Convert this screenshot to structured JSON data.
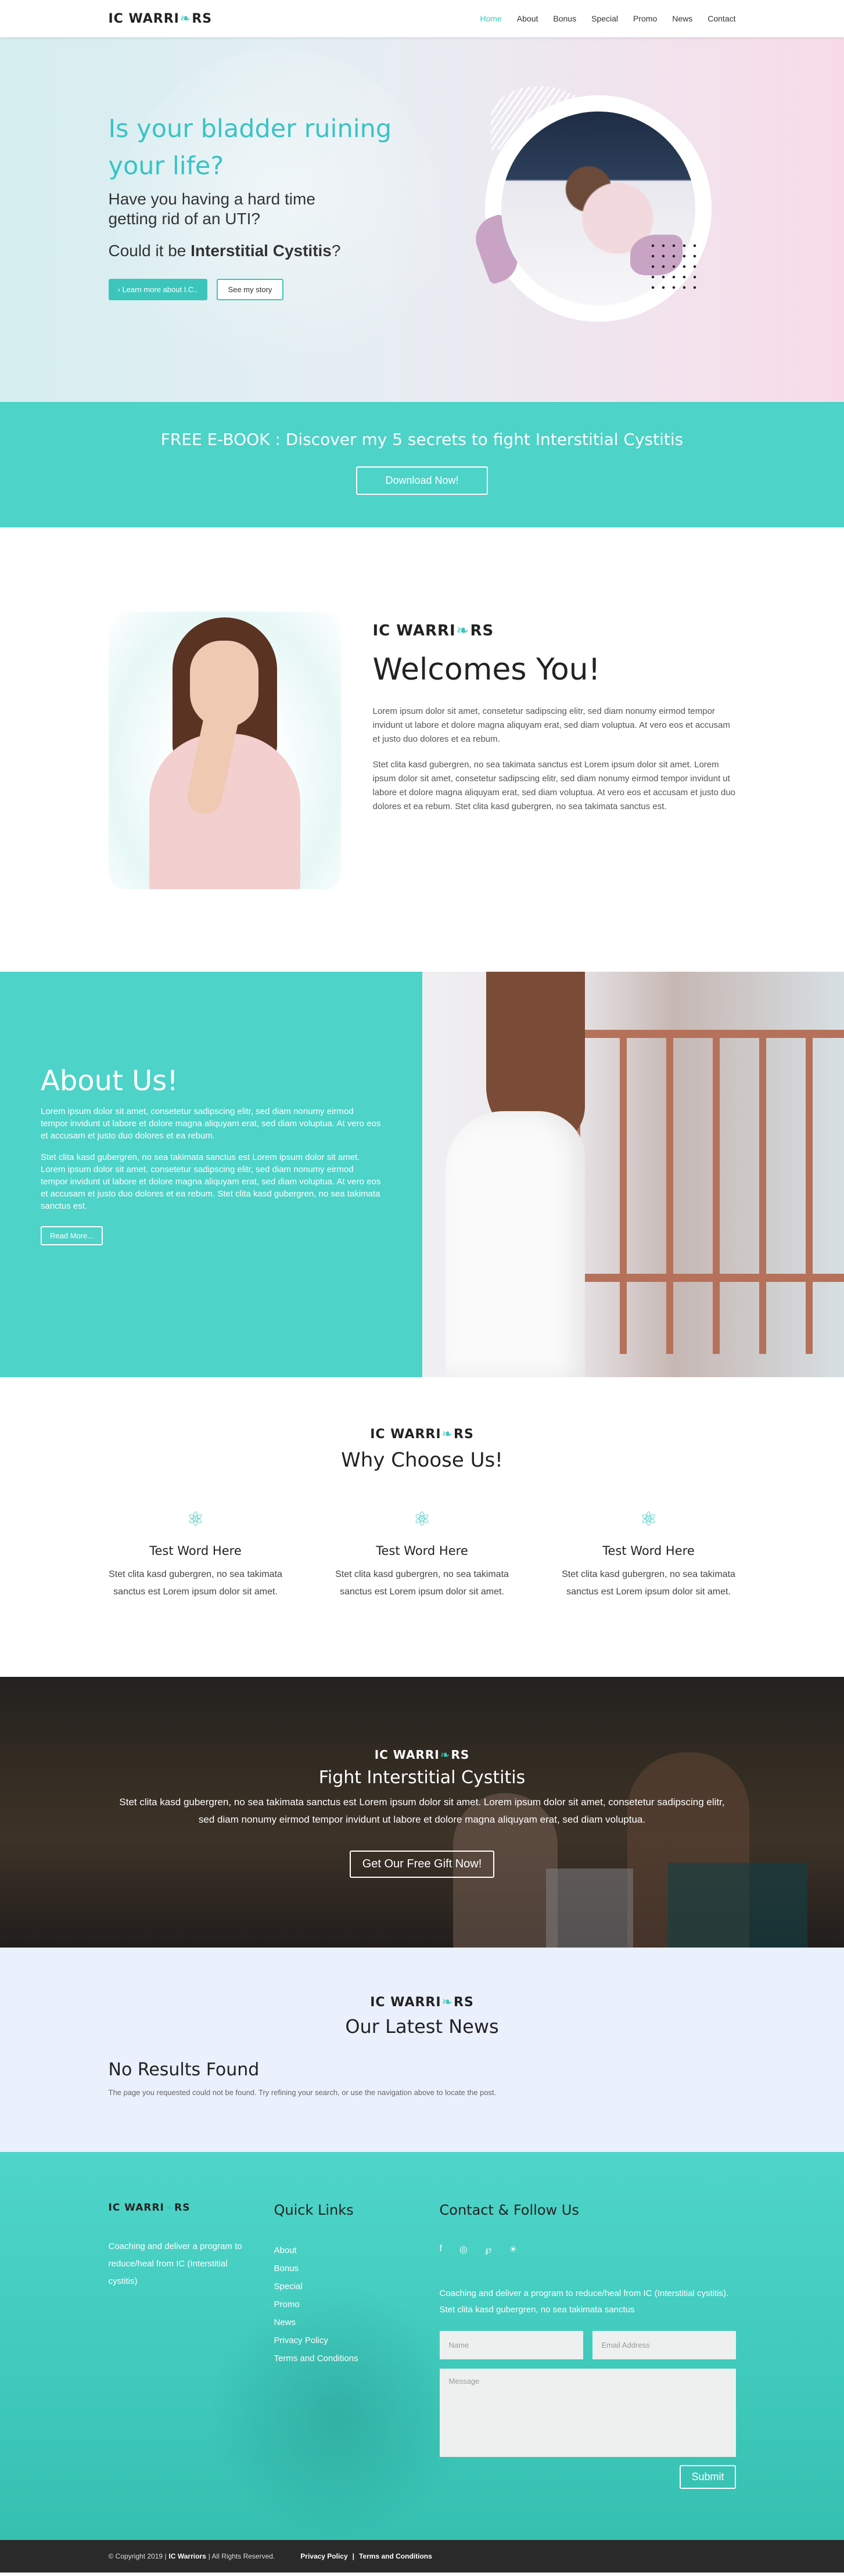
{
  "brand": {
    "logo_left": "IC WARRI",
    "logo_right": "RS"
  },
  "nav": {
    "items": [
      {
        "label": "Home"
      },
      {
        "label": "About"
      },
      {
        "label": "Bonus"
      },
      {
        "label": "Special"
      },
      {
        "label": "Promo"
      },
      {
        "label": "News"
      },
      {
        "label": "Contact"
      }
    ]
  },
  "hero": {
    "title": "Is your bladder ruining your life?",
    "subtitle": "Have you having a hard time getting rid of an UTI?",
    "question_prefix": "Could it be ",
    "question_bold": "Interstitial Cystitis",
    "question_suffix": "?",
    "btn_primary": "Learn more about I.C..",
    "btn_secondary": "See my story"
  },
  "ebook": {
    "title": "FREE E-BOOK : Discover my 5 secrets to fight Interstitial Cystitis",
    "button": "Download Now!"
  },
  "welcome": {
    "heading": "Welcomes You!",
    "p1": "Lorem ipsum dolor sit amet, consetetur sadipscing elitr, sed diam nonumy eirmod tempor invidunt ut labore et dolore magna aliquyam erat, sed diam voluptua. At vero eos et accusam et justo duo dolores et ea rebum.",
    "p2": "Stet clita kasd gubergren, no sea takimata sanctus est Lorem ipsum dolor sit amet. Lorem ipsum dolor sit amet, consetetur sadipscing elitr, sed diam nonumy eirmod tempor invidunt ut labore et dolore magna aliquyam erat, sed diam voluptua. At vero eos et accusam et justo duo dolores et ea rebum. Stet clita kasd gubergren, no sea takimata sanctus est."
  },
  "about": {
    "heading": "About Us!",
    "p1": "Lorem ipsum dolor sit amet, consetetur sadipscing elitr, sed diam nonumy eirmod tempor invidunt ut labore et dolore magna aliquyam erat, sed diam voluptua. At vero eos et accusam et justo duo dolores et ea rebum.",
    "p2": "Stet clita kasd gubergren, no sea takimata sanctus est Lorem ipsum dolor sit amet. Lorem ipsum dolor sit amet, consetetur sadipscing elitr, sed diam nonumy eirmod tempor invidunt ut labore et dolore magna aliquyam erat, sed diam voluptua. At vero eos et accusam et justo duo dolores et ea rebum. Stet clita kasd gubergren, no sea takimata sanctus est.",
    "button": "Read More..."
  },
  "why": {
    "heading": "Why Choose Us!",
    "cols": [
      {
        "icon": "atom-icon",
        "title": "Test Word Here",
        "text": "Stet clita kasd gubergren, no sea takimata sanctus est Lorem ipsum dolor sit amet."
      },
      {
        "icon": "atom-icon",
        "title": "Test Word Here",
        "text": "Stet clita kasd gubergren, no sea takimata sanctus est Lorem ipsum dolor sit amet."
      },
      {
        "icon": "atom-icon",
        "title": "Test Word Here",
        "text": "Stet clita kasd gubergren, no sea takimata sanctus est Lorem ipsum dolor sit amet."
      }
    ]
  },
  "fight": {
    "heading": "Fight Interstitial Cystitis",
    "text": "Stet clita kasd gubergren, no sea takimata sanctus est Lorem ipsum dolor sit amet. Lorem ipsum dolor sit amet, consetetur sadipscing elitr, sed diam nonumy eirmod tempor invidunt ut labore et dolore magna aliquyam erat, sed diam voluptua.",
    "button": "Get Our Free Gift Now!"
  },
  "news": {
    "heading": "Our Latest News",
    "empty_title": "No Results Found",
    "empty_text": "The page you requested could not be found. Try refining your search, or use the navigation above to locate the post."
  },
  "footer": {
    "about_text": "Coaching and deliver a program to reduce/heal from IC (Interstitial cystitis)",
    "quick_links_title": "Quick Links",
    "quick_links": [
      "About",
      "Bonus",
      "Special",
      "Promo",
      "News",
      "Privacy Policy",
      "Terms and Conditions"
    ],
    "contact_title": "Contact & Follow Us",
    "contact_text": "Coaching and deliver a program to reduce/heal from IC (Interstitial cystitis). Stet clita kasd gubergren, no sea takimata sanctus",
    "name_placeholder": "Name",
    "email_placeholder": "Email Address",
    "message_placeholder": "Message",
    "submit": "Submit"
  },
  "copyright": {
    "prefix": "© Copyright 2019 |",
    "brand": "IC Warriors",
    "suffix": "| All Rights Reserved.",
    "privacy": "Privacy Policy",
    "sep": "|",
    "terms": "Terms and Conditions"
  },
  "colors": {
    "accent": "#3cc6bb",
    "banner": "#4dd3c8",
    "news_bg": "#eaf0fc",
    "footer_bar": "#2a2a2a"
  }
}
